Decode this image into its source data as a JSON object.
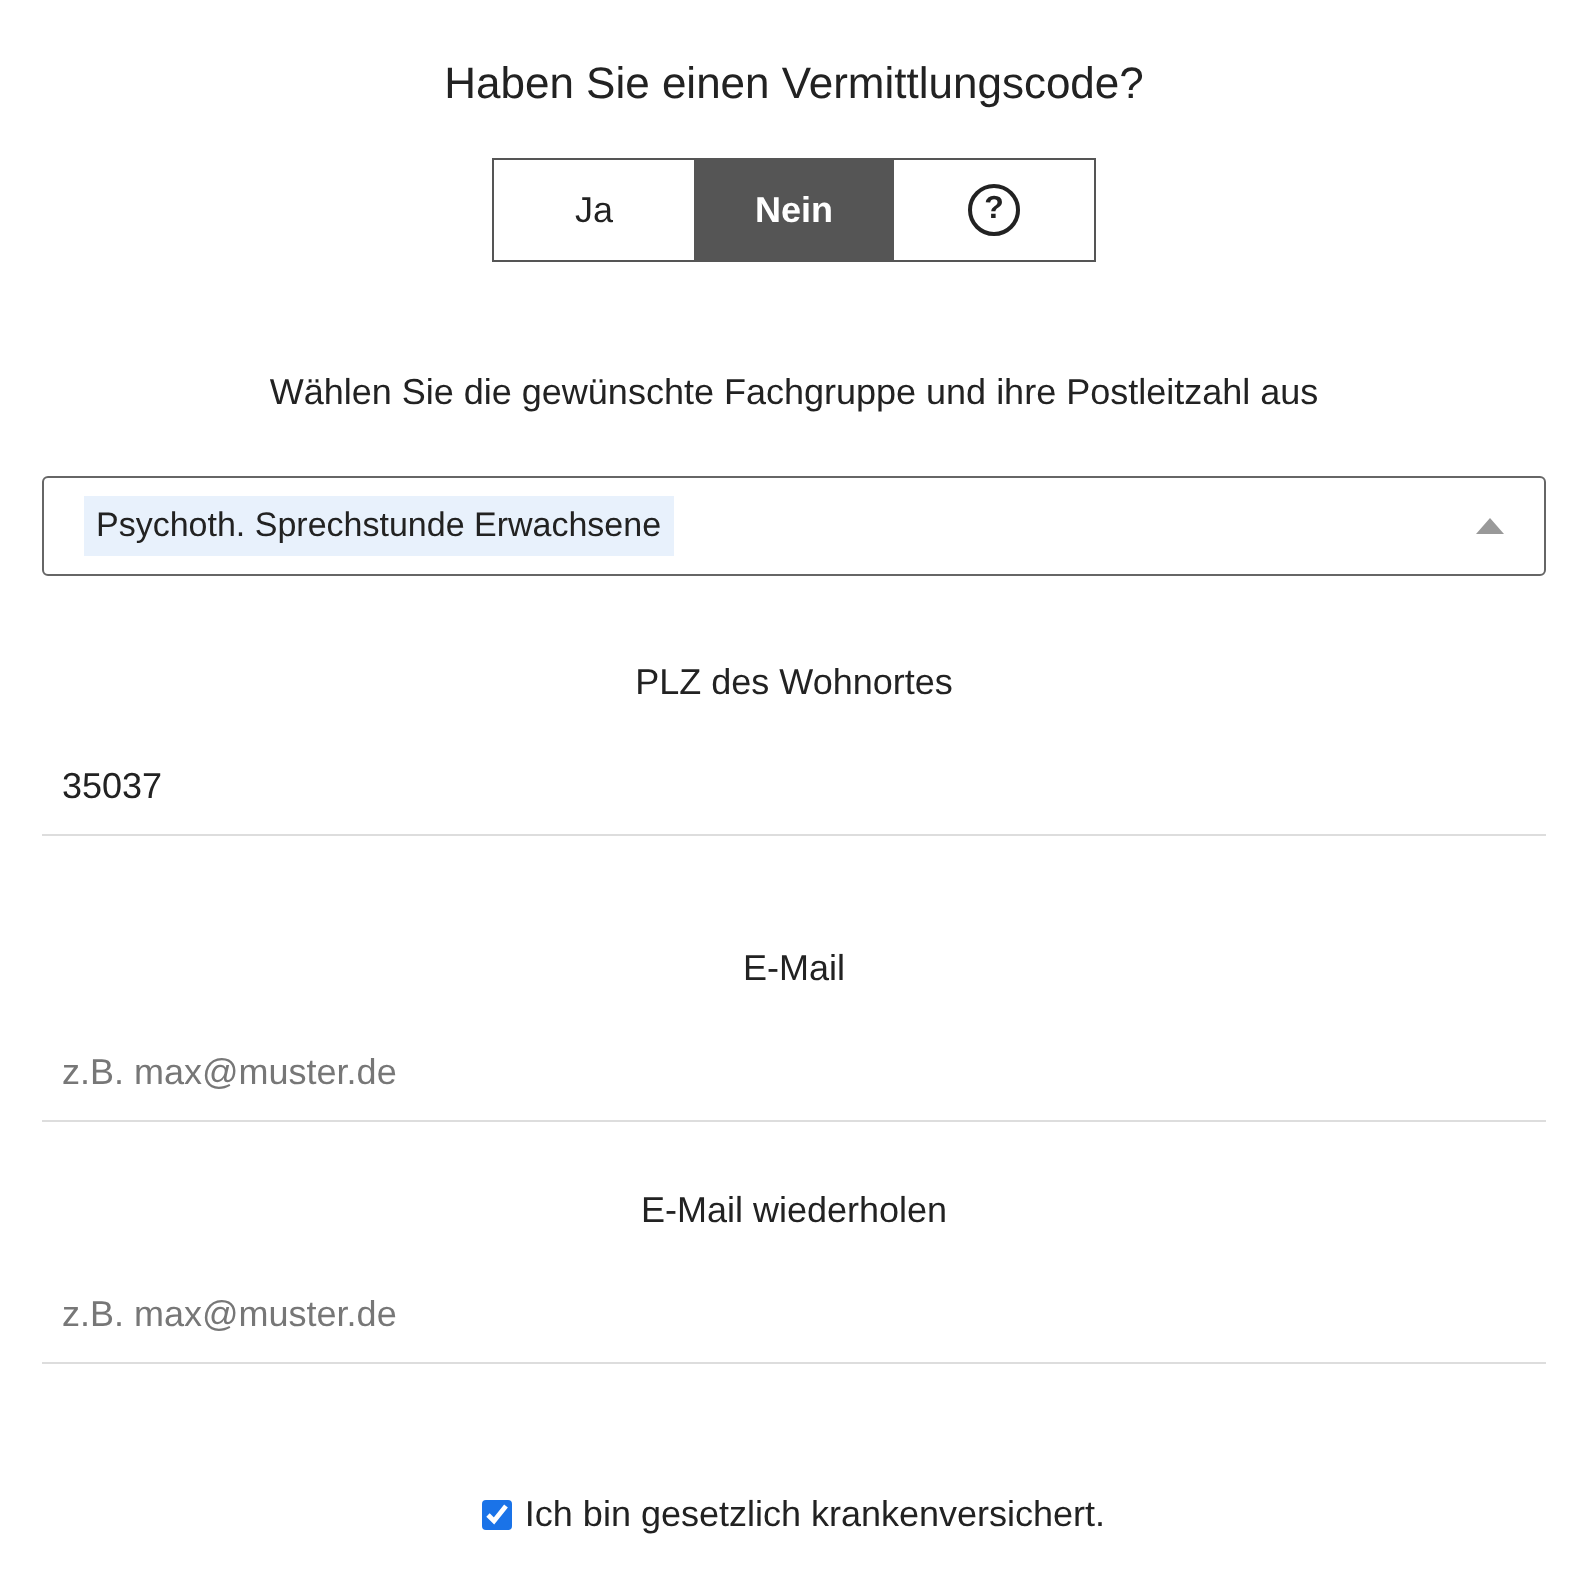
{
  "heading": "Haben Sie einen Vermittlungscode?",
  "code_toggle": [
    {
      "label": "Ja",
      "selected": false,
      "kind": "text"
    },
    {
      "label": "Nein",
      "selected": true,
      "kind": "text"
    },
    {
      "label": "?",
      "selected": false,
      "kind": "help"
    }
  ],
  "instruction": "Wählen Sie die gewünschte Fachgruppe und ihre Postleitzahl aus",
  "specialty_select": {
    "value": "Psychoth. Sprechstunde Erwachsene",
    "expanded": true
  },
  "fields": [
    {
      "label": "PLZ des Wohnortes",
      "value": "35037"
    },
    {
      "label": "E-Mail",
      "placeholder": "z.B. max@muster.de"
    },
    {
      "label": "E-Mail wiederholen",
      "placeholder": "z.B. max@muster.de"
    }
  ],
  "insurance_checkbox": {
    "label": "Ich bin gesetzlich krankenversichert.",
    "checked": true
  }
}
